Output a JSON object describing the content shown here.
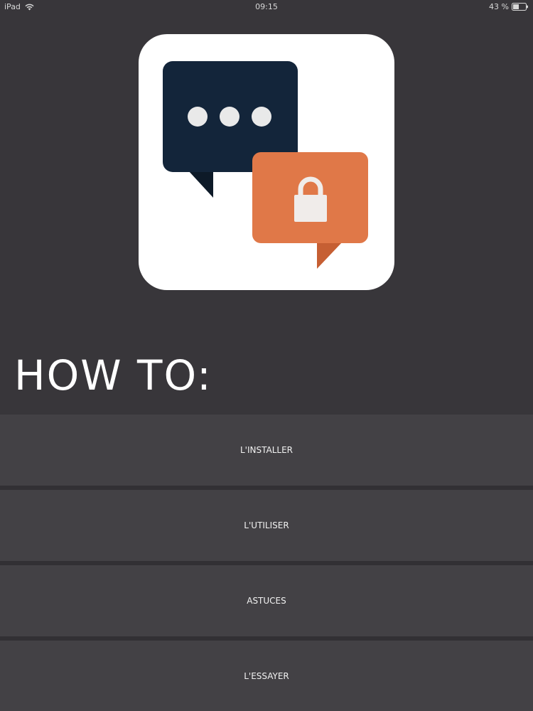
{
  "status_bar": {
    "device": "iPad",
    "time": "09:15",
    "battery": "43 %",
    "icons": [
      "wifi-icon",
      "battery-icon"
    ]
  },
  "app_icon": {
    "icon": "secure-chat-lock-icon",
    "colors": {
      "background": "#ffffff",
      "dark_bubble": "#13253a",
      "orange_bubble": "#e07848",
      "orange_tail": "#c65f33",
      "dots": "#e9e9e9",
      "lock": "#f0ecea"
    }
  },
  "heading": {
    "title": "HOW TO:"
  },
  "menu": {
    "items": [
      {
        "label": "L'INSTALLER"
      },
      {
        "label": "L'UTILISER"
      },
      {
        "label": "ASTUCES"
      },
      {
        "label": "L'ESSAYER"
      }
    ]
  },
  "colors": {
    "screen_background": "#38363a",
    "button_background": "#434145",
    "button_divider": "#323034",
    "text": "#ffffff"
  }
}
